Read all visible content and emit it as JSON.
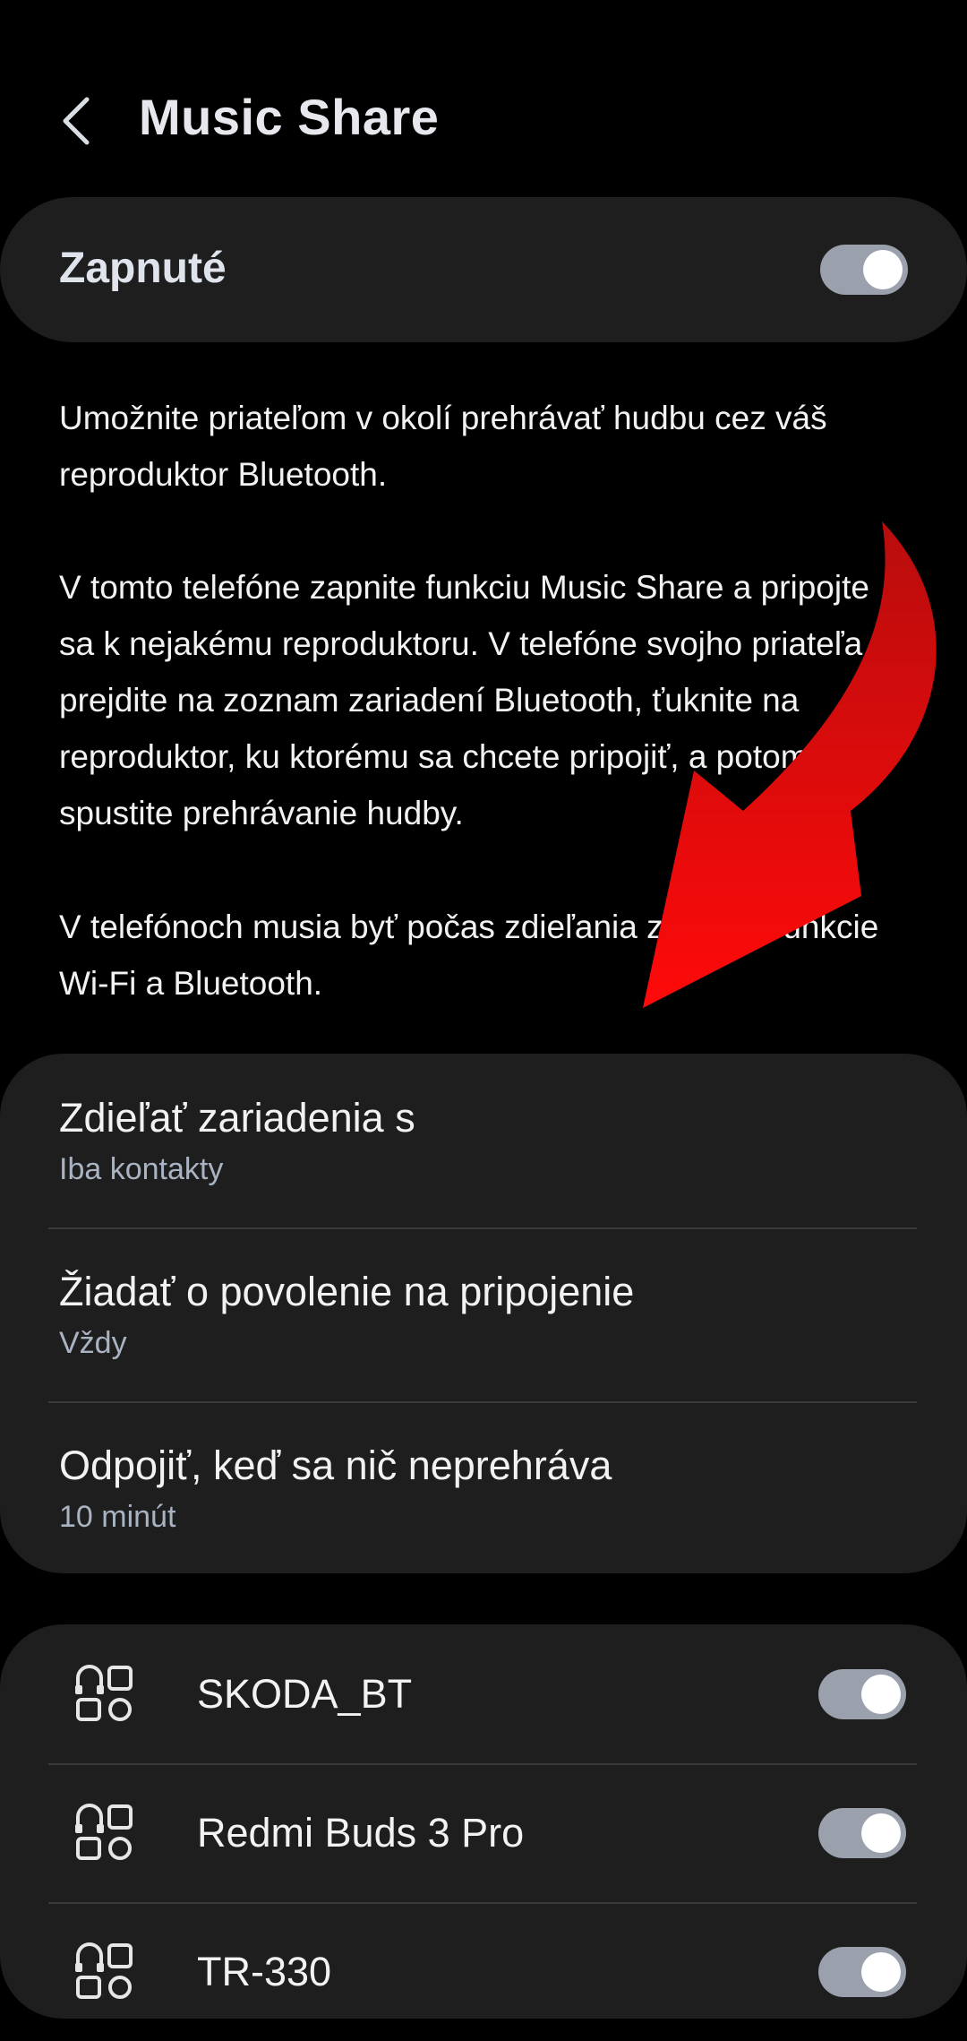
{
  "header": {
    "title": "Music Share",
    "back_icon": "chevron-left-icon"
  },
  "master_switch": {
    "label": "Zapnuté",
    "on": true
  },
  "description": {
    "paragraph1": "Umožnite priateľom v okolí prehrávať hudbu cez váš reproduktor Bluetooth.",
    "paragraph2": "V tomto telefóne zapnite funkciu Music Share a pripojte sa k nejakému reproduktoru. V telefóne svojho priateľa prejdite na zoznam zariadení Bluetooth, ťuknite na reproduktor, ku ktorému sa chcete pripojiť, a potom spustite prehrávanie hudby.",
    "paragraph3": "V telefónoch musia byť počas zdieľania zapnuté funkcie Wi-Fi a Bluetooth."
  },
  "settings": [
    {
      "title": "Zdieľať zariadenia s",
      "value": "Iba kontakty"
    },
    {
      "title": "Žiadať o povolenie na pripojenie",
      "value": "Vždy"
    },
    {
      "title": "Odpojiť, keď sa nič neprehráva",
      "value": "10 minút"
    }
  ],
  "devices": [
    {
      "name": "SKODA_BT",
      "icon": "device-group-icon",
      "enabled": true
    },
    {
      "name": "Redmi Buds 3 Pro",
      "icon": "device-group-icon",
      "enabled": true
    },
    {
      "name": "TR-330",
      "icon": "device-group-icon",
      "enabled": true
    }
  ],
  "colors": {
    "background": "#000000",
    "card": "#1e1e1e",
    "toggle_on": "#9aa1ad",
    "annotation_arrow": "#e10f0f"
  }
}
